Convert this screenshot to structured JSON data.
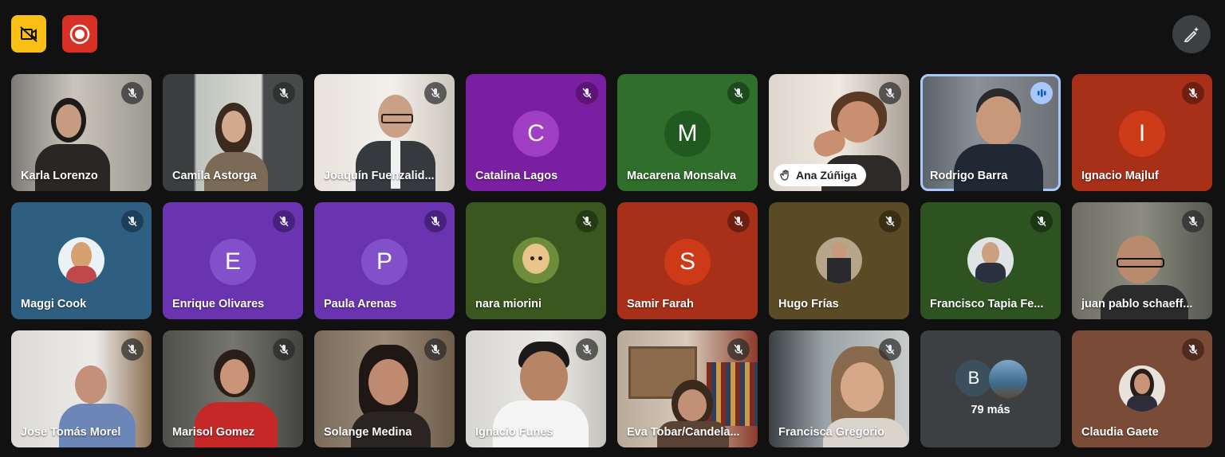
{
  "toolbar": {
    "camera_off_icon": "videocam-off-icon",
    "record_icon": "record-icon",
    "edit_icon": "pen-sparkle-icon",
    "colors": {
      "camera_off": "#f9bf14",
      "record": "#d93025"
    }
  },
  "participants": [
    {
      "name": "Karla Lorenzo",
      "type": "video",
      "muted": true
    },
    {
      "name": "Camila Astorga",
      "type": "video",
      "muted": true
    },
    {
      "name": "Joaquín Fuenzalid...",
      "type": "video",
      "muted": true
    },
    {
      "name": "Catalina Lagos",
      "type": "letter",
      "initial": "C",
      "muted": true,
      "color": "#8e24aa"
    },
    {
      "name": "Macarena Monsalva",
      "type": "letter",
      "initial": "M",
      "muted": true,
      "color": "#2e6b2e"
    },
    {
      "name": "Ana Zúñiga",
      "type": "video",
      "muted": true,
      "hand_raised": true
    },
    {
      "name": "Rodrigo Barra",
      "type": "video",
      "speaking": true
    },
    {
      "name": "Ignacio Majluf",
      "type": "letter",
      "initial": "I",
      "muted": true,
      "color": "#b3361b"
    },
    {
      "name": "Maggi Cook",
      "type": "photo",
      "muted": true
    },
    {
      "name": "Enrique Olivares",
      "type": "letter",
      "initial": "E",
      "muted": true,
      "color": "#6a3ab6"
    },
    {
      "name": "Paula Arenas",
      "type": "letter",
      "initial": "P",
      "muted": true,
      "color": "#6a3ab6"
    },
    {
      "name": "nara miorini",
      "type": "photo",
      "muted": true
    },
    {
      "name": "Samir Farah",
      "type": "letter",
      "initial": "S",
      "muted": true,
      "color": "#b3361b"
    },
    {
      "name": "Hugo Frías",
      "type": "photo",
      "muted": true
    },
    {
      "name": "Francisco Tapia Fe...",
      "type": "photo",
      "muted": true
    },
    {
      "name": "juan pablo schaeff...",
      "type": "video",
      "muted": true
    },
    {
      "name": "Jose Tomás Morel",
      "type": "video",
      "muted": true
    },
    {
      "name": "Marisol Gomez",
      "type": "video",
      "muted": true
    },
    {
      "name": "Solange Medina",
      "type": "video",
      "muted": true
    },
    {
      "name": "Ignacio Funes",
      "type": "video",
      "muted": true
    },
    {
      "name": "Eva Tobar/Candela...",
      "type": "video",
      "muted": true
    },
    {
      "name": "Francisca Gregorio",
      "type": "video",
      "muted": true
    },
    {
      "name": "more",
      "type": "more",
      "initial": "B"
    },
    {
      "name": "Claudia Gaete",
      "type": "photo",
      "muted": true
    }
  ],
  "more_tile": {
    "initial": "B",
    "label": "79 más"
  }
}
